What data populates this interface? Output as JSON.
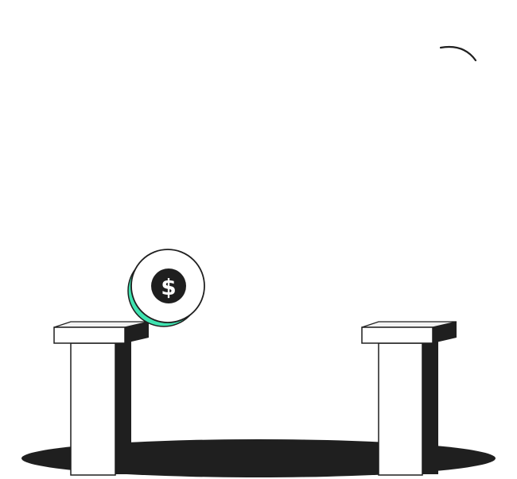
{
  "illustration": {
    "coin_symbol": "$",
    "icons": [
      "coin-icon",
      "dollar-sign-icon",
      "pillar-left",
      "pillar-right",
      "hole-shadow",
      "motion-arc"
    ],
    "colors": {
      "background": "#ffffff",
      "ink": "#1f1f1f",
      "accent": "#3fe3b0",
      "pillar_face": "#ffffff",
      "pillar_top": "#f2f2f2"
    }
  }
}
